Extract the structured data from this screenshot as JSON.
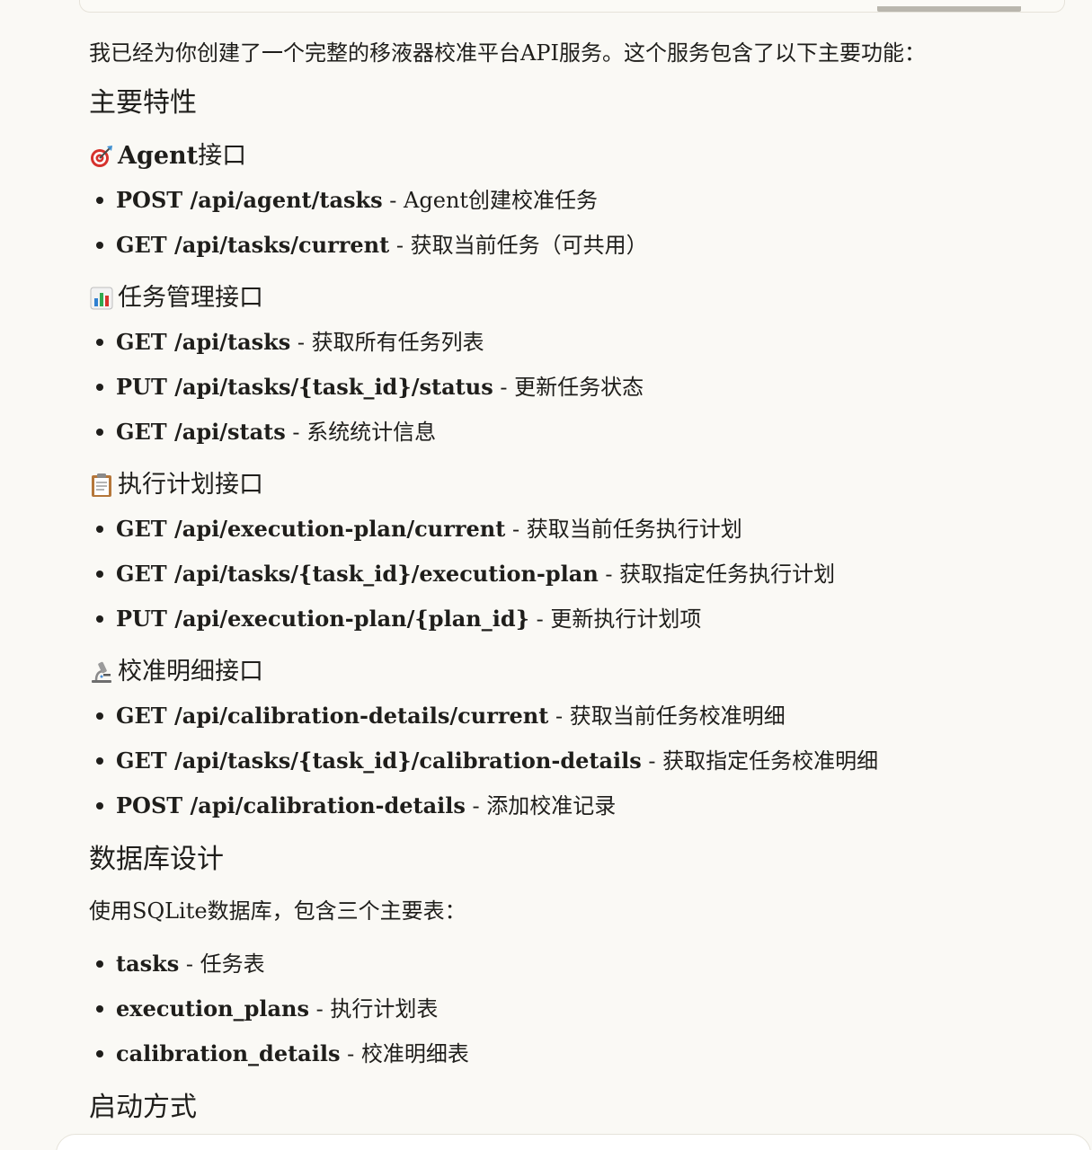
{
  "intro": "我已经为你创建了一个完整的移液器校准平台API服务。这个服务包含了以下主要功能：",
  "features_heading": "主要特性",
  "sections": [
    {
      "icon": "target-icon",
      "title_en": "Agent",
      "title_zh": "接口",
      "items": [
        {
          "endpoint": "POST /api/agent/tasks",
          "desc": " - Agent创建校准任务"
        },
        {
          "endpoint": "GET /api/tasks/current",
          "desc": " - 获取当前任务（可共用）"
        }
      ]
    },
    {
      "icon": "bar-chart-icon",
      "title_en": "",
      "title_zh": "任务管理接口",
      "items": [
        {
          "endpoint": "GET /api/tasks",
          "desc": " - 获取所有任务列表"
        },
        {
          "endpoint": "PUT /api/tasks/{task_id}/status",
          "desc": " - 更新任务状态"
        },
        {
          "endpoint": "GET /api/stats",
          "desc": " - 系统统计信息"
        }
      ]
    },
    {
      "icon": "clipboard-icon",
      "title_en": "",
      "title_zh": "执行计划接口",
      "items": [
        {
          "endpoint": "GET /api/execution-plan/current",
          "desc": " - 获取当前任务执行计划"
        },
        {
          "endpoint": "GET /api/tasks/{task_id}/execution-plan",
          "desc": " - 获取指定任务执行计划"
        },
        {
          "endpoint": "PUT /api/execution-plan/{plan_id}",
          "desc": " - 更新执行计划项"
        }
      ]
    },
    {
      "icon": "microscope-icon",
      "title_en": "",
      "title_zh": "校准明细接口",
      "items": [
        {
          "endpoint": "GET /api/calibration-details/current",
          "desc": " - 获取当前任务校准明细"
        },
        {
          "endpoint": "GET /api/tasks/{task_id}/calibration-details",
          "desc": " - 获取指定任务校准明细"
        },
        {
          "endpoint": "POST /api/calibration-details",
          "desc": " - 添加校准记录"
        }
      ]
    }
  ],
  "database": {
    "heading": "数据库设计",
    "intro": "使用SQLite数据库，包含三个主要表：",
    "tables": [
      {
        "name": "tasks",
        "desc": " - 任务表"
      },
      {
        "name": "execution_plans",
        "desc": " - 执行计划表"
      },
      {
        "name": "calibration_details",
        "desc": " - 校准明细表"
      }
    ]
  },
  "startup_heading": "启动方式"
}
